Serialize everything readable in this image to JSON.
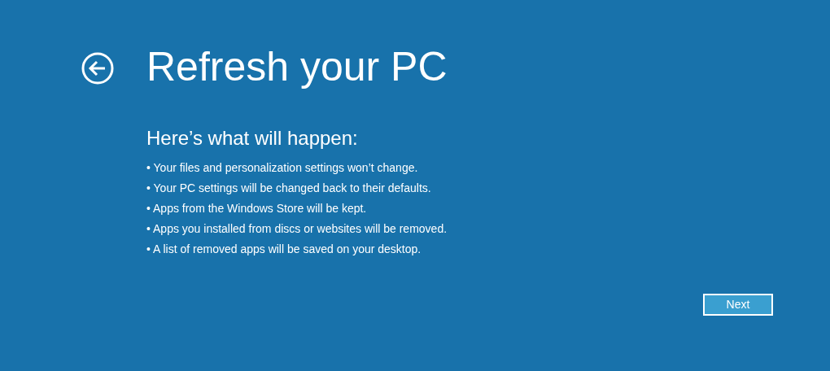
{
  "title": "Refresh your PC",
  "subtitle": "Here’s what will happen:",
  "items": [
    "• Your files and personalization settings won’t change.",
    "• Your PC settings will be changed back to their defaults.",
    "• Apps from the Windows Store will be kept.",
    "• Apps you installed from discs or websites will be removed.",
    "• A list of removed apps will be saved on your desktop."
  ],
  "buttons": [
    {
      "label": "Next"
    }
  ]
}
